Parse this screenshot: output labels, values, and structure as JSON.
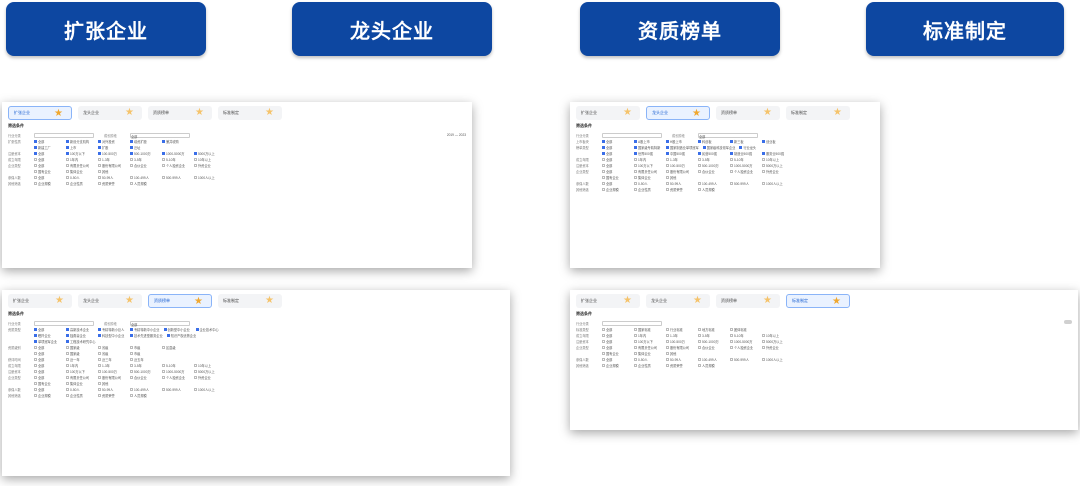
{
  "top_buttons": [
    "扩张企业",
    "龙头企业",
    "资质榜单",
    "标准制定"
  ],
  "panels": [
    {
      "tabs": [
        "扩张企业",
        "龙头企业",
        "资质榜单",
        "标准制定"
      ],
      "active": 0,
      "filter_title": "筛选条件",
      "field1_label": "行业分类",
      "field2_label": "成长阶段",
      "field2_value": "全部",
      "year_range": "2019 — 2023",
      "rows": [
        {
          "label": "扩张性质",
          "items": [
            "全部",
            "新设分支机构",
            "对外投资",
            "增资扩股",
            "兼并收购"
          ]
        },
        {
          "label": "",
          "items": [
            "新建工厂",
            "上市",
            "扩股",
            "迁址"
          ]
        },
        {
          "label": "注册资本",
          "items": [
            "全部",
            "100万以下",
            "100-500万",
            "500-1000万",
            "1000-5000万",
            "5000万以上"
          ]
        },
        {
          "label": "成立年限",
          "items": [
            "全部",
            "1年内",
            "1-3年",
            "3-5年",
            "5-10年",
            "10年以上"
          ]
        },
        {
          "label": "企业类型",
          "items": [
            "全部",
            "有限责任公司",
            "股份有限公司",
            "合伙企业",
            "个人独资企业",
            "外资企业"
          ]
        },
        {
          "label": "",
          "items": [
            "国有企业",
            "集体企业",
            "其他"
          ]
        },
        {
          "label": "参保人数",
          "items": [
            "全部",
            "0-50人",
            "50-99人",
            "100-499人",
            "500-999人",
            "1000人以上"
          ]
        },
        {
          "label": "其他筛选",
          "items": [
            "企业规模",
            "企业性质",
            "资质荣誉",
            "人员规模"
          ]
        }
      ]
    },
    {
      "tabs": [
        "扩张企业",
        "龙头企业",
        "资质榜单",
        "标准制定"
      ],
      "active": 1,
      "filter_title": "筛选条件",
      "field1_label": "行业分类",
      "field2_label": "成长阶段",
      "field2_value": "全部",
      "year_range": "",
      "rows": [
        {
          "label": "上市板块",
          "items": [
            "全部",
            "A股上市",
            "H股上市",
            "科创板",
            "新三板",
            "创业板"
          ]
        },
        {
          "label": "榜单类型",
          "items": [
            "全部",
            "国家级专精特新",
            "国家制造业单项冠军",
            "国家级科技领军企业",
            "行业龙头"
          ]
        },
        {
          "label": "",
          "items": [
            "全部",
            "世界500强",
            "中国500强",
            "民营500强",
            "制造业500强",
            "服务业500强"
          ]
        },
        {
          "label": "成立年限",
          "items": [
            "全部",
            "1年内",
            "1-3年",
            "3-5年",
            "5-10年",
            "10年以上"
          ]
        },
        {
          "label": "注册资本",
          "items": [
            "全部",
            "100万以下",
            "100-500万",
            "500-1000万",
            "1000-5000万",
            "5000万以上"
          ]
        },
        {
          "label": "企业类型",
          "items": [
            "全部",
            "有限责任公司",
            "股份有限公司",
            "合伙企业",
            "个人独资企业",
            "外资企业"
          ]
        },
        {
          "label": "",
          "items": [
            "国有企业",
            "集体企业",
            "其他"
          ]
        },
        {
          "label": "参保人数",
          "items": [
            "全部",
            "0-50人",
            "50-99人",
            "100-499人",
            "500-999人",
            "1000人以上"
          ]
        },
        {
          "label": "其他筛选",
          "items": [
            "企业规模",
            "企业性质",
            "资质荣誉",
            "人员规模"
          ]
        }
      ]
    },
    {
      "tabs": [
        "扩张企业",
        "龙头企业",
        "资质榜单",
        "标准制定"
      ],
      "active": 2,
      "filter_title": "筛选条件",
      "field1_label": "行业分类",
      "field2_label": "成长阶段",
      "field2_value": "全部",
      "year_range": "",
      "rows": [
        {
          "label": "资质类型",
          "items": [
            "全部",
            "高新技术企业",
            "专精特新小巨人",
            "专精特新中小企业",
            "创新型中小企业",
            "企业技术中心"
          ]
        },
        {
          "label": "",
          "items": [
            "瞪羚企业",
            "独角兽企业",
            "科技型中小企业",
            "技术先进型服务企业",
            "知识产权优势企业"
          ]
        },
        {
          "label": "",
          "items": [
            "单项冠军企业",
            "工程技术研究中心"
          ]
        },
        {
          "label": "资质级别",
          "items": [
            "全部",
            "国家级",
            "省级",
            "市级",
            "区县级"
          ]
        },
        {
          "label": "",
          "items": [
            "全部",
            "国家级",
            "省级",
            "市级"
          ]
        },
        {
          "label": "获评时间",
          "items": [
            "全部",
            "近一年",
            "近三年",
            "近五年"
          ]
        },
        {
          "label": "成立年限",
          "items": [
            "全部",
            "1年内",
            "1-3年",
            "3-5年",
            "5-10年",
            "10年以上"
          ]
        },
        {
          "label": "注册资本",
          "items": [
            "全部",
            "100万以下",
            "100-500万",
            "500-1000万",
            "1000-5000万",
            "5000万以上"
          ]
        },
        {
          "label": "企业类型",
          "items": [
            "全部",
            "有限责任公司",
            "股份有限公司",
            "合伙企业",
            "个人独资企业",
            "外资企业"
          ]
        },
        {
          "label": "",
          "items": [
            "国有企业",
            "集体企业",
            "其他"
          ]
        },
        {
          "label": "参保人数",
          "items": [
            "全部",
            "0-50人",
            "50-99人",
            "100-499人",
            "500-999人",
            "1000人以上"
          ]
        },
        {
          "label": "其他筛选",
          "items": [
            "企业规模",
            "企业性质",
            "资质荣誉",
            "人员规模"
          ]
        }
      ]
    },
    {
      "tabs": [
        "扩张企业",
        "龙头企业",
        "资质榜单",
        "标准制定"
      ],
      "active": 3,
      "filter_title": "筛选条件",
      "field1_label": "行业分类",
      "field2_label": "",
      "field2_value": "",
      "year_range": "",
      "rows": [
        {
          "label": "标准类型",
          "items": [
            "全部",
            "国家标准",
            "行业标准",
            "地方标准",
            "团体标准"
          ]
        },
        {
          "label": "成立年限",
          "items": [
            "全部",
            "1年内",
            "1-3年",
            "3-5年",
            "5-10年",
            "10年以上"
          ]
        },
        {
          "label": "注册资本",
          "items": [
            "全部",
            "100万以下",
            "100-500万",
            "500-1000万",
            "1000-5000万",
            "5000万以上"
          ]
        },
        {
          "label": "企业类型",
          "items": [
            "全部",
            "有限责任公司",
            "股份有限公司",
            "合伙企业",
            "个人独资企业",
            "外资企业"
          ]
        },
        {
          "label": "",
          "items": [
            "国有企业",
            "集体企业",
            "其他"
          ]
        },
        {
          "label": "参保人数",
          "items": [
            "全部",
            "0-50人",
            "50-99人",
            "100-499人",
            "500-999人",
            "1000人以上"
          ]
        },
        {
          "label": "其他筛选",
          "items": [
            "企业规模",
            "企业性质",
            "资质荣誉",
            "人员规模"
          ]
        }
      ]
    }
  ]
}
